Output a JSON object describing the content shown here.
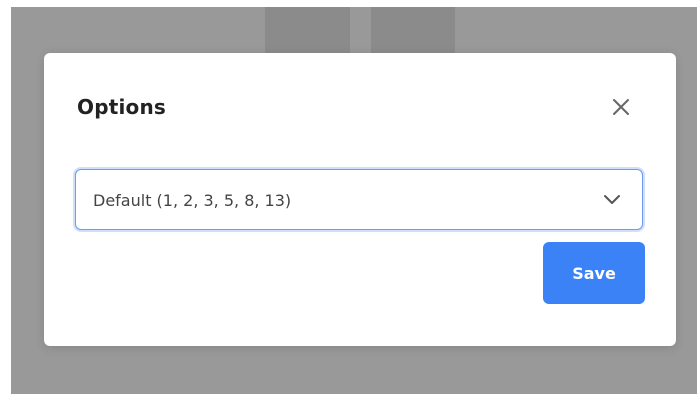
{
  "modal": {
    "title": "Options",
    "close_icon": "close-icon",
    "select": {
      "value": "Default (1, 2, 3, 5, 8, 13)",
      "icon": "chevron-down-icon"
    },
    "save_label": "Save"
  },
  "colors": {
    "backdrop": "#999999",
    "backdrop_blocks": "#8b8b8b",
    "accent": "#3b82f6",
    "focus_border": "#6b9cf0",
    "title_text": "#222222",
    "select_text": "#444444"
  }
}
